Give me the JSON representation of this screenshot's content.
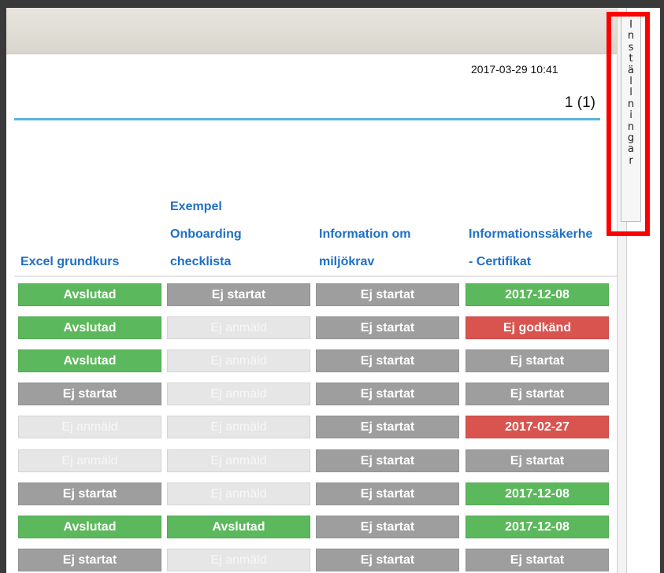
{
  "header": {
    "datetime": "2017-03-29 10:41",
    "pager": "1 (1)"
  },
  "settings_tab": {
    "label": "Inställningar",
    "letters": [
      "I",
      "n",
      "s",
      "t",
      "ä",
      "l",
      "l",
      "n",
      "i",
      "n",
      "g",
      "a",
      "r"
    ]
  },
  "columns": [
    {
      "lines": [
        "Excel grundkurs"
      ]
    },
    {
      "lines": [
        "Exempel",
        "Onboarding",
        "checklista"
      ]
    },
    {
      "lines": [
        "Information om",
        "miljökrav"
      ]
    },
    {
      "lines": [
        "Informationssäkerhe",
        "- Certifikat"
      ]
    }
  ],
  "rows": [
    [
      {
        "text": "Avslutad",
        "status": "done"
      },
      {
        "text": "Ej startat",
        "status": "ns"
      },
      {
        "text": "Ej startat",
        "status": "ns"
      },
      {
        "text": "2017-12-08",
        "status": "done"
      }
    ],
    [
      {
        "text": "Avslutad",
        "status": "done"
      },
      {
        "text": "Ej anmäld",
        "status": "na"
      },
      {
        "text": "Ej startat",
        "status": "ns"
      },
      {
        "text": "Ej godkänd",
        "status": "fail"
      }
    ],
    [
      {
        "text": "Avslutad",
        "status": "done"
      },
      {
        "text": "Ej anmäld",
        "status": "na"
      },
      {
        "text": "Ej startat",
        "status": "ns"
      },
      {
        "text": "Ej startat",
        "status": "ns"
      }
    ],
    [
      {
        "text": "Ej startat",
        "status": "ns"
      },
      {
        "text": "Ej anmäld",
        "status": "na"
      },
      {
        "text": "Ej startat",
        "status": "ns"
      },
      {
        "text": "Ej startat",
        "status": "ns"
      }
    ],
    [
      {
        "text": "Ej anmäld",
        "status": "na"
      },
      {
        "text": "Ej anmäld",
        "status": "na"
      },
      {
        "text": "Ej startat",
        "status": "ns"
      },
      {
        "text": "2017-02-27",
        "status": "fail"
      }
    ],
    [
      {
        "text": "Ej anmäld",
        "status": "na"
      },
      {
        "text": "Ej anmäld",
        "status": "na"
      },
      {
        "text": "Ej startat",
        "status": "ns"
      },
      {
        "text": "Ej startat",
        "status": "ns"
      }
    ],
    [
      {
        "text": "Ej startat",
        "status": "ns"
      },
      {
        "text": "Ej anmäld",
        "status": "na"
      },
      {
        "text": "Ej startat",
        "status": "ns"
      },
      {
        "text": "2017-12-08",
        "status": "done"
      }
    ],
    [
      {
        "text": "Avslutad",
        "status": "done"
      },
      {
        "text": "Avslutad",
        "status": "done"
      },
      {
        "text": "Ej startat",
        "status": "ns"
      },
      {
        "text": "2017-12-08",
        "status": "done"
      }
    ],
    [
      {
        "text": "Ej startat",
        "status": "ns"
      },
      {
        "text": "Ej anmäld",
        "status": "na"
      },
      {
        "text": "Ej startat",
        "status": "ns"
      },
      {
        "text": "Ej startat",
        "status": "ns"
      }
    ]
  ],
  "colors": {
    "done": "#5cb85c",
    "not_started": "#9e9e9e",
    "not_registered": "#e6e6e6",
    "failed": "#d9534f",
    "header_link": "#1f6fc6",
    "accent_line": "#59b6dd",
    "highlight": "#ff0000"
  }
}
